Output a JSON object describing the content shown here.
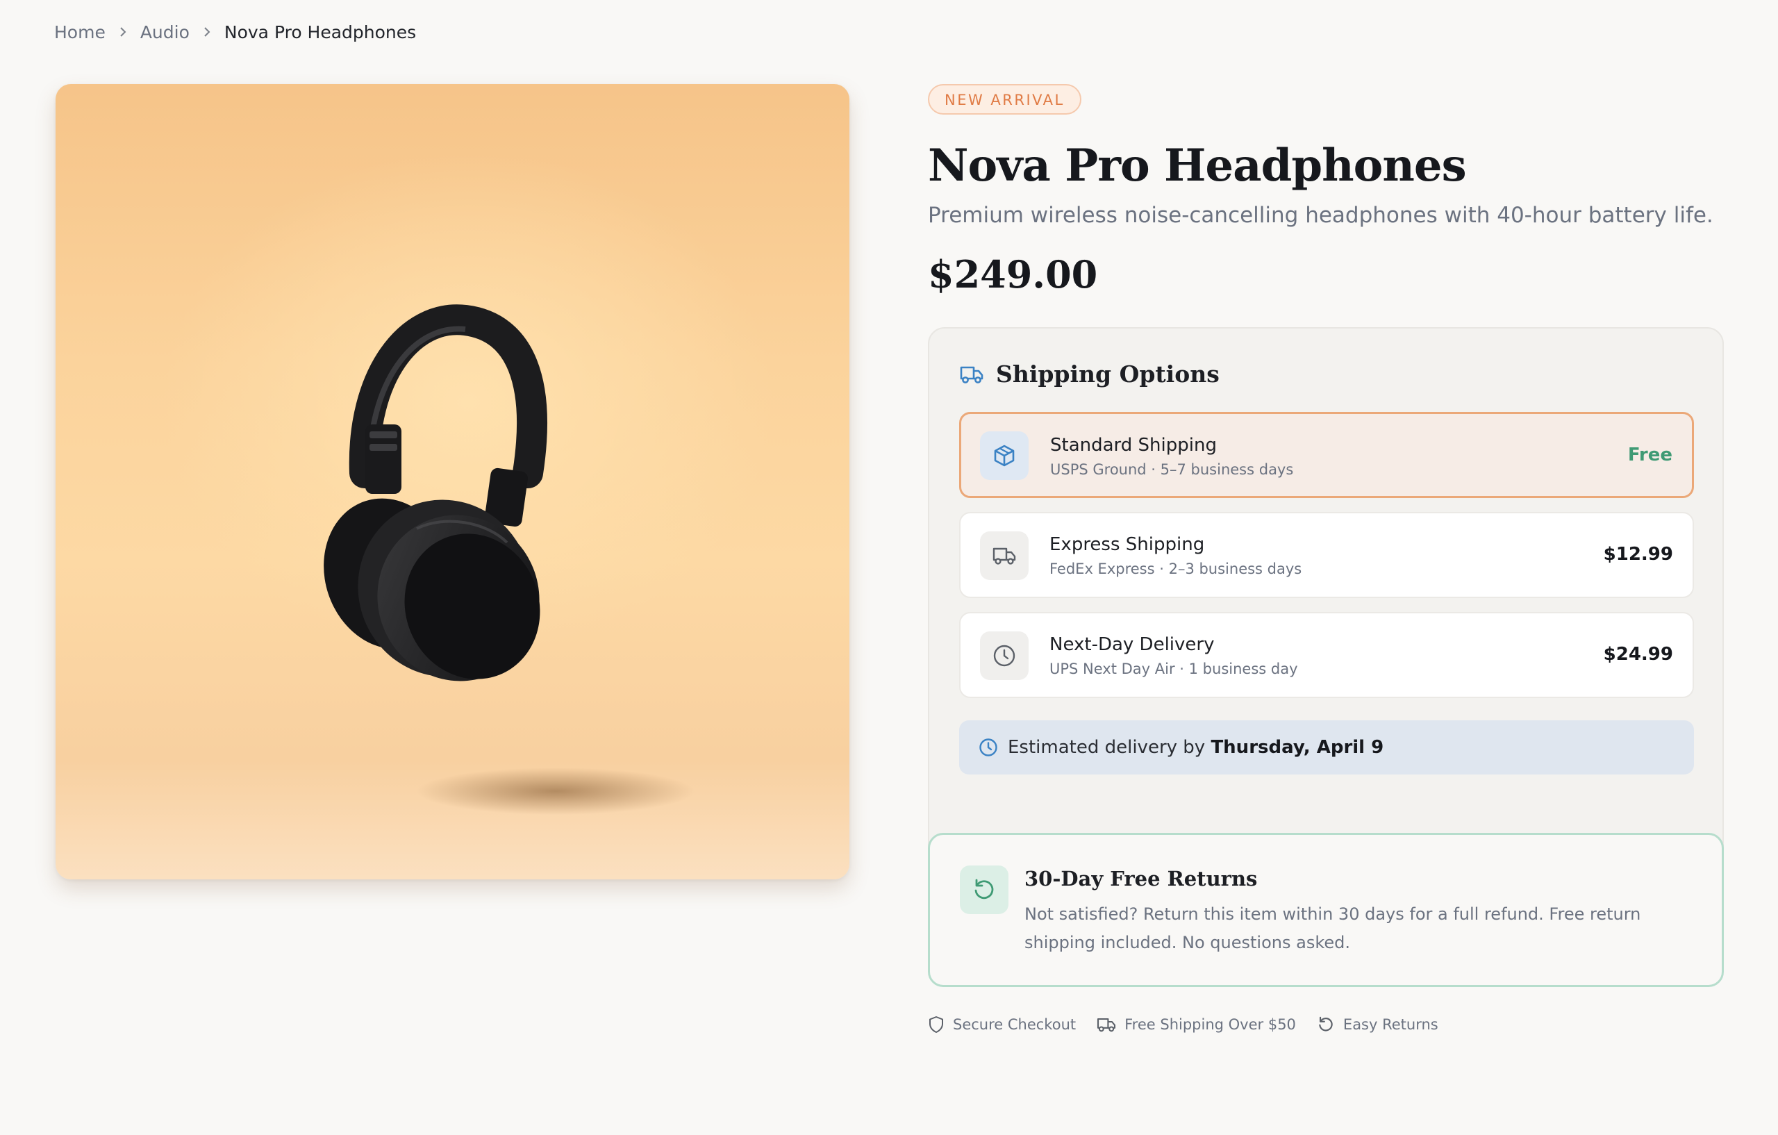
{
  "breadcrumb": {
    "items": [
      "Home",
      "Audio"
    ],
    "current": "Nova Pro Headphones"
  },
  "product": {
    "badge": "NEW ARRIVAL",
    "title": "Nova Pro Headphones",
    "subtitle": "Premium wireless noise-cancelling headphones with 40-hour battery life.",
    "price": "$249.00",
    "image_icon": "headphones-product-photo"
  },
  "shipping": {
    "heading": "Shipping Options",
    "heading_icon": "truck-icon",
    "options": [
      {
        "name": "Standard Shipping",
        "meta": "USPS Ground · 5–7 business days",
        "cost": "Free",
        "icon": "package-icon",
        "selected": true
      },
      {
        "name": "Express Shipping",
        "meta": "FedEx Express · 2–3 business days",
        "cost": "$12.99",
        "icon": "truck-icon",
        "selected": false
      },
      {
        "name": "Next-Day Delivery",
        "meta": "UPS Next Day Air · 1 business day",
        "cost": "$24.99",
        "icon": "clock-icon",
        "selected": false
      }
    ],
    "estimate_prefix": "Estimated delivery by",
    "estimate_date": "Thursday, April 9"
  },
  "returns": {
    "title": "30-Day Free Returns",
    "description": "Not satisfied? Return this item within 30 days for a full refund. Free return shipping included. No questions asked.",
    "icon": "return-arrow-icon"
  },
  "trust": [
    {
      "label": "Secure Checkout",
      "icon": "shield-icon"
    },
    {
      "label": "Free Shipping Over $50",
      "icon": "truck-icon"
    },
    {
      "label": "Easy Returns",
      "icon": "return-arrow-icon"
    }
  ],
  "colors": {
    "accent_orange": "#eba878",
    "free_green": "#3f9a74",
    "icon_blue": "#3b82c4",
    "returns_green": "#b6ddcc"
  }
}
